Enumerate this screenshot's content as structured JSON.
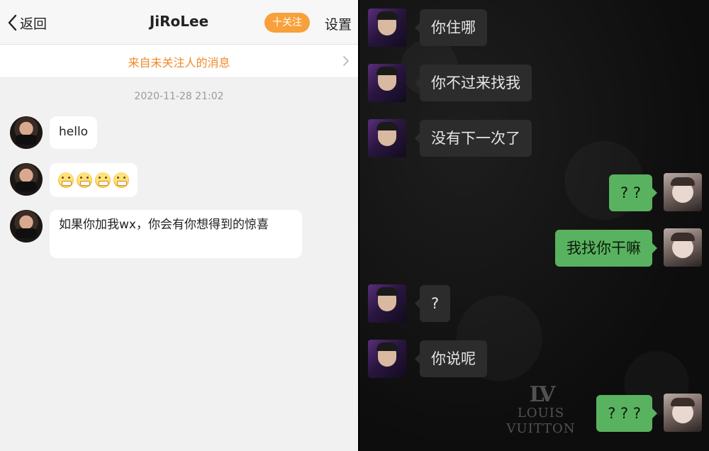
{
  "left_chat": {
    "header": {
      "back_label": "返回",
      "title": "JiRoLee",
      "follow_label": "十关注",
      "settings_label": "设置"
    },
    "notice": "来自未关注人的消息",
    "timestamp": "2020-11-28 21:02",
    "messages": [
      {
        "sender": "JiRoLee",
        "text": "hello"
      },
      {
        "sender": "JiRoLee",
        "emoji": "grimace-emoji",
        "emoji_count": 4
      },
      {
        "sender": "JiRoLee",
        "text": "如果你加我wx，你会有你想得到的惊喜"
      }
    ],
    "colors": {
      "accent": "#f8a03a",
      "notice_text": "#ef8a2a",
      "background": "#f1f1f1"
    }
  },
  "right_chat": {
    "messages": [
      {
        "from": "other",
        "text": "你住哪"
      },
      {
        "from": "other",
        "text": "你不过来找我"
      },
      {
        "from": "other",
        "text": "没有下一次了"
      },
      {
        "from": "me",
        "text": "? ?"
      },
      {
        "from": "me",
        "text": "我找你干嘛"
      },
      {
        "from": "other",
        "text": "?"
      },
      {
        "from": "other",
        "text": "你说呢"
      },
      {
        "from": "me",
        "text": "? ? ?"
      }
    ],
    "watermark": {
      "logo": "LV",
      "text": "LOUIS VUITTON"
    },
    "colors": {
      "incoming_bubble": "#2c2c2c",
      "outgoing_bubble": "#59b25f",
      "background": "#0d0d0d"
    }
  }
}
